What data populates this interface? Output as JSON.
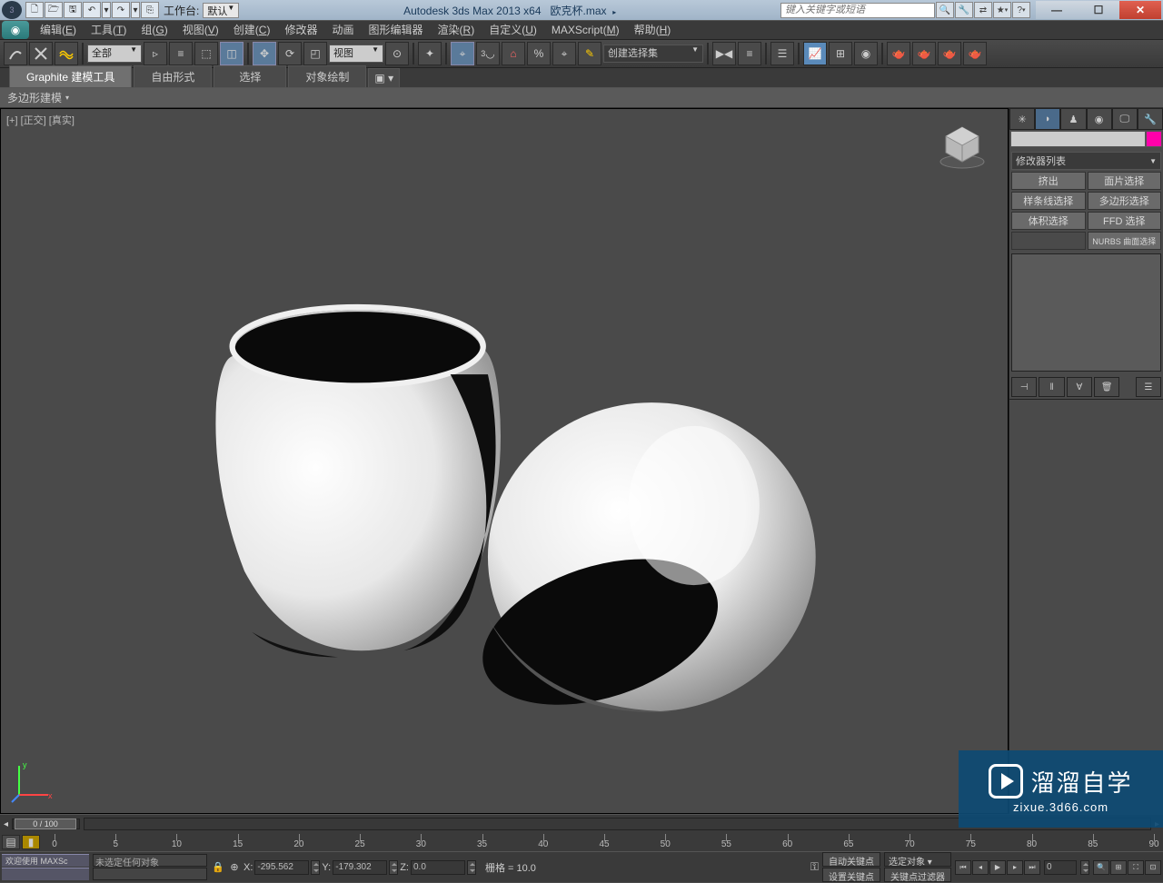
{
  "title": {
    "app": "Autodesk 3ds Max  2013 x64",
    "file": "欧克杯.max",
    "workspace_label": "工作台:",
    "workspace_value": "默认",
    "search_placeholder": "键入关键字或短语"
  },
  "quickaccess": [
    "new",
    "open",
    "save",
    "undo",
    "undo-dd",
    "redo",
    "redo-dd",
    "link"
  ],
  "menus": [
    {
      "label": "编辑",
      "key": "E"
    },
    {
      "label": "工具",
      "key": "T"
    },
    {
      "label": "组",
      "key": "G"
    },
    {
      "label": "视图",
      "key": "V"
    },
    {
      "label": "创建",
      "key": "C"
    },
    {
      "label": "修改器",
      "key": ""
    },
    {
      "label": "动画",
      "key": ""
    },
    {
      "label": "图形编辑器",
      "key": ""
    },
    {
      "label": "渲染",
      "key": "R"
    },
    {
      "label": "自定义",
      "key": "U"
    },
    {
      "label": "MAXScript",
      "key": "M"
    },
    {
      "label": "帮助",
      "key": "H"
    }
  ],
  "toolbar": {
    "selection_filter": "全部",
    "ref_coord": "视图",
    "named_sets": "创建选择集"
  },
  "ribbon": {
    "tabs": [
      "Graphite 建模工具",
      "自由形式",
      "选择",
      "对象绘制"
    ],
    "panel": "多边形建模"
  },
  "viewport": {
    "label": "[+] [正交] [真实]"
  },
  "cmdpanel": {
    "modlist": "修改器列表",
    "cells": [
      "挤出",
      "面片选择",
      "样条线选择",
      "多边形选择",
      "体积选择",
      "FFD 选择",
      "",
      "NURBS 曲面选择"
    ]
  },
  "timeline": {
    "frame_text": "0 / 100",
    "ticks": [
      0,
      5,
      10,
      15,
      20,
      25,
      30,
      35,
      40,
      45,
      50,
      55,
      60,
      65,
      70,
      75,
      80,
      85,
      90
    ]
  },
  "status": {
    "tab1": "欢迎使用 MAXSc",
    "tab2": "",
    "prompt": "未选定任何对象",
    "x_label": "X:",
    "x_val": "-295.562",
    "y_label": "Y:",
    "y_val": "-179.302",
    "z_label": "Z:",
    "z_val": "0.0",
    "grid": "栅格 = 10.0",
    "autokey": "自动关键点",
    "setkey": "设置关键点",
    "selected": "选定对象",
    "keyfilter": "关键点过滤器"
  },
  "watermark": {
    "brand": "溜溜自学",
    "url": "zixue.3d66.com"
  }
}
